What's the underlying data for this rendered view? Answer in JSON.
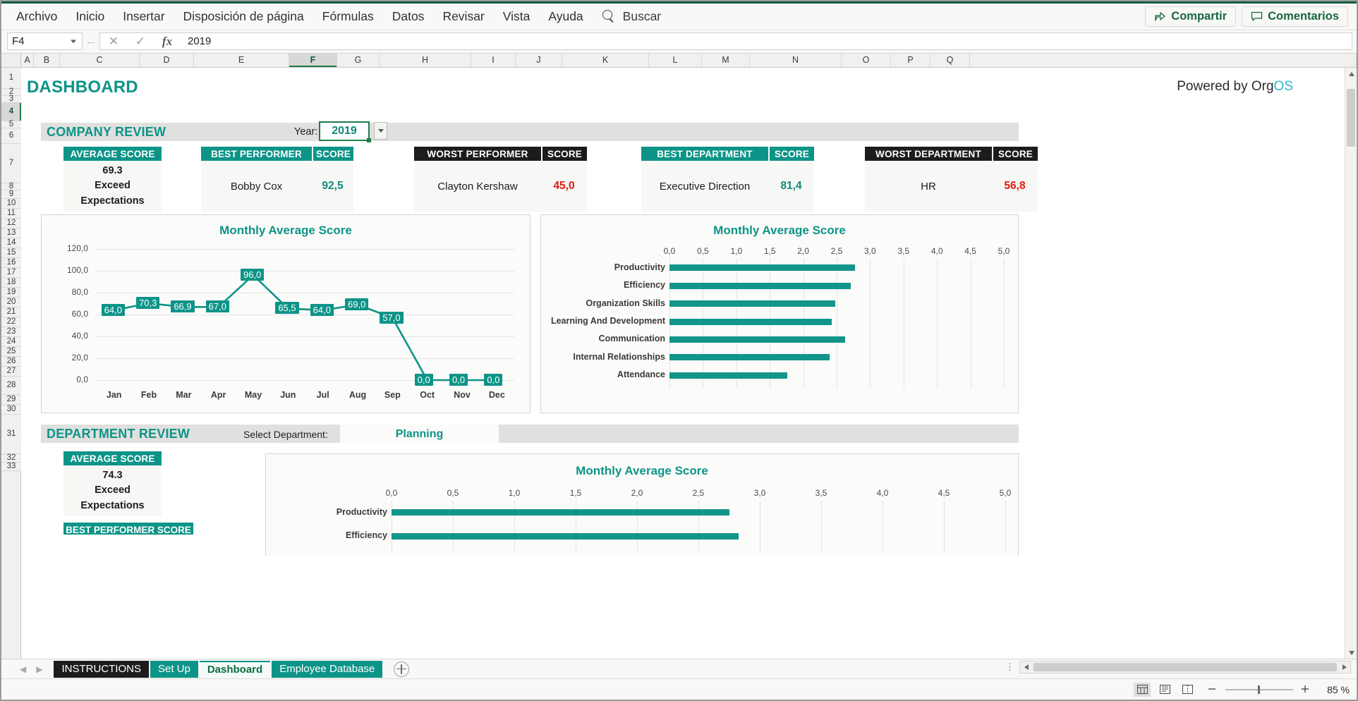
{
  "ribbon": {
    "menus": [
      "Archivo",
      "Inicio",
      "Insertar",
      "Disposición de página",
      "Fórmulas",
      "Datos",
      "Revisar",
      "Vista",
      "Ayuda"
    ],
    "search_placeholder": "Buscar",
    "share_label": "Compartir",
    "comments_label": "Comentarios"
  },
  "formula_bar": {
    "name_box": "F4",
    "formula_value": "2019"
  },
  "grid": {
    "columns": [
      "A",
      "B",
      "C",
      "D",
      "E",
      "F",
      "G",
      "H",
      "I",
      "J",
      "K",
      "L",
      "M",
      "N",
      "O",
      "P",
      "Q"
    ],
    "selected_column": "F",
    "rows": [
      "1",
      "2",
      "3",
      "4",
      "5",
      "6",
      "7",
      "8",
      "9",
      "10",
      "11",
      "12",
      "13",
      "14",
      "15",
      "16",
      "17",
      "18",
      "19",
      "20",
      "21",
      "22",
      "23",
      "24",
      "25",
      "26",
      "27",
      "28",
      "29",
      "30",
      "31",
      "32",
      "33"
    ],
    "selected_row": "4"
  },
  "dashboard": {
    "title": "DASHBOARD",
    "powered_prefix": "Powered by Org",
    "powered_suffix": "OS",
    "company_review": {
      "band_title": "COMPANY REVIEW",
      "year_label": "Year:",
      "year_value": "2019",
      "cards": [
        {
          "header": "AVERAGE SCORE",
          "style": "teal",
          "value": "69.3",
          "line2": "Exceed",
          "line3": "Expectations"
        },
        {
          "header": "BEST PERFORMER",
          "score_header": "SCORE",
          "style": "teal",
          "name": "Bobby Cox",
          "score": "92,5",
          "score_tone": "good"
        },
        {
          "header": "WORST PERFORMER",
          "score_header": "SCORE",
          "style": "dark",
          "name": "Clayton Kershaw",
          "score": "45,0",
          "score_tone": "bad"
        },
        {
          "header": "BEST DEPARTMENT",
          "score_header": "SCORE",
          "style": "teal",
          "name": "Executive Direction",
          "score": "81,4",
          "score_tone": "good"
        },
        {
          "header": "WORST DEPARTMENT",
          "score_header": "SCORE",
          "style": "dark",
          "name": "HR",
          "score": "56,8",
          "score_tone": "bad"
        }
      ]
    },
    "department_review": {
      "band_title": "DEPARTMENT REVIEW",
      "select_label": "Select Department:",
      "selected_department": "Planning",
      "avg_card": {
        "header": "AVERAGE SCORE",
        "value": "74.3",
        "line2": "Exceed",
        "line3": "Expectations"
      },
      "best_card_header": "BEST PERFORMER  SCORE"
    }
  },
  "chart_data": [
    {
      "id": "company-line",
      "type": "line",
      "title": "Monthly Average Score",
      "xlabel": "",
      "ylabel": "",
      "categories": [
        "Jan",
        "Feb",
        "Mar",
        "Apr",
        "May",
        "Jun",
        "Jul",
        "Aug",
        "Sep",
        "Oct",
        "Nov",
        "Dec"
      ],
      "values": [
        64.0,
        70.3,
        66.9,
        67.0,
        96.0,
        65.5,
        64.0,
        69.0,
        57.0,
        0.0,
        0.0,
        0.0
      ],
      "data_labels": [
        "64,0",
        "70,3",
        "66,9",
        "67,0",
        "96,0",
        "65,5",
        "64,0",
        "69,0",
        "57,0",
        "0,0",
        "0,0",
        "0,0"
      ],
      "ylim": [
        0,
        120
      ],
      "yticks": [
        0,
        20,
        40,
        60,
        80,
        100,
        120
      ],
      "ytick_labels": [
        "0,0",
        "20,0",
        "40,0",
        "60,0",
        "80,0",
        "100,0",
        "120,0"
      ],
      "grid": true,
      "legend": "none",
      "series_color": "#0d9488"
    },
    {
      "id": "company-bars",
      "type": "bar",
      "orientation": "horizontal",
      "title": "Monthly Average Score",
      "categories": [
        "Productivity",
        "Efficiency",
        "Organization Skills",
        "Learning And Development",
        "Communication",
        "Internal Relationships",
        "Attendance"
      ],
      "values": [
        2.77,
        2.71,
        2.48,
        2.43,
        2.63,
        2.39,
        1.76
      ],
      "xlim": [
        0,
        5
      ],
      "xticks": [
        0,
        0.5,
        1,
        1.5,
        2,
        2.5,
        3,
        3.5,
        4,
        4.5,
        5
      ],
      "xtick_labels": [
        "0,0",
        "0,5",
        "1,0",
        "1,5",
        "2,0",
        "2,5",
        "3,0",
        "3,5",
        "4,0",
        "4,5",
        "5,0"
      ],
      "grid": true,
      "legend": "none",
      "series_color": "#12958b"
    },
    {
      "id": "department-bars",
      "type": "bar",
      "orientation": "horizontal",
      "title": "Monthly Average Score",
      "categories": [
        "Productivity",
        "Efficiency"
      ],
      "values": [
        2.75,
        2.83
      ],
      "xlim": [
        0,
        5
      ],
      "xticks": [
        0,
        0.5,
        1,
        1.5,
        2,
        2.5,
        3,
        3.5,
        4,
        4.5,
        5
      ],
      "xtick_labels": [
        "0,0",
        "0,5",
        "1,0",
        "1,5",
        "2,0",
        "2,5",
        "3,0",
        "3,5",
        "4,0",
        "4,5",
        "5,0"
      ],
      "grid": true,
      "legend": "none",
      "series_color": "#12958b"
    }
  ],
  "sheet_tabs": [
    {
      "label": "INSTRUCTIONS",
      "style": "inst"
    },
    {
      "label": "Set Up",
      "style": "teal"
    },
    {
      "label": "Dashboard",
      "style": "active"
    },
    {
      "label": "Employee Database",
      "style": "teal"
    }
  ],
  "status_bar": {
    "zoom": "85 %"
  }
}
